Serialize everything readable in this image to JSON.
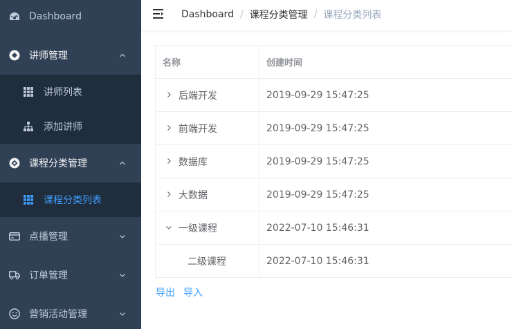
{
  "sidebar": {
    "items": [
      {
        "label": "Dashboard",
        "icon": "dashboard-icon"
      },
      {
        "label": "讲师管理",
        "icon": "teacher-icon"
      },
      {
        "label": "讲师列表",
        "icon": "table-icon"
      },
      {
        "label": "添加讲师",
        "icon": "tree-icon"
      },
      {
        "label": "课程分类管理",
        "icon": "category-icon"
      },
      {
        "label": "课程分类列表",
        "icon": "table-icon"
      },
      {
        "label": "点播管理",
        "icon": "card-icon"
      },
      {
        "label": "订单管理",
        "icon": "truck-icon"
      },
      {
        "label": "营销活动管理",
        "icon": "activity-icon"
      }
    ],
    "active_color": "#409eff",
    "bg_color": "#304156",
    "sub_bg_color": "#1f2d3d"
  },
  "breadcrumb": {
    "items": [
      "Dashboard",
      "课程分类管理",
      "课程分类列表"
    ],
    "separator": "/"
  },
  "table": {
    "headers": [
      "名称",
      "创建时间"
    ],
    "rows": [
      {
        "name": "后端开发",
        "created": "2019-09-29 15:47:25",
        "expanded": false
      },
      {
        "name": "前端开发",
        "created": "2019-09-29 15:47:25",
        "expanded": false
      },
      {
        "name": "数据库",
        "created": "2019-09-29 15:47:25",
        "expanded": false
      },
      {
        "name": "大数据",
        "created": "2019-09-29 15:47:25",
        "expanded": false
      },
      {
        "name": "一级课程",
        "created": "2022-07-10 15:46:31",
        "expanded": true
      },
      {
        "name": "二级课程",
        "created": "2022-07-10 15:46:31",
        "child": true
      }
    ]
  },
  "actions": {
    "export_label": "导出",
    "import_label": "导入"
  }
}
